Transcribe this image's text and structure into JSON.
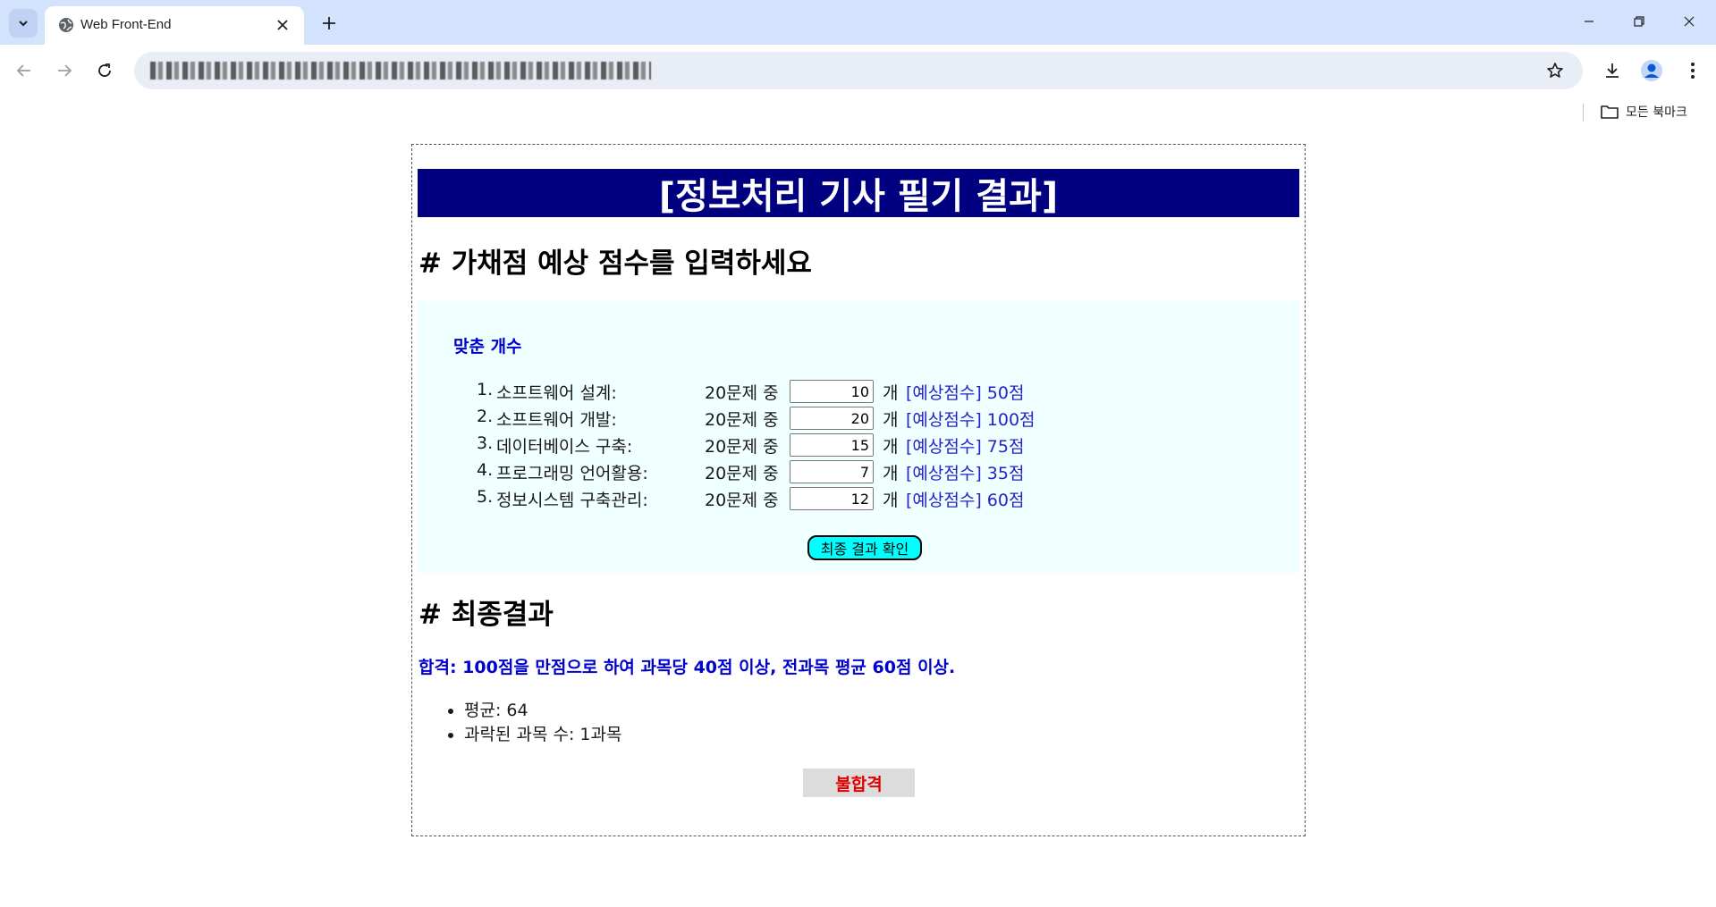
{
  "browser": {
    "tab_title": "Web Front-End",
    "bookmarks_label": "모든 북마크",
    "icons": {
      "tab_dropdown": "chevron-down-icon",
      "tab_favicon": "globe-icon",
      "tab_close": "close-icon",
      "new_tab": "plus-icon",
      "back": "arrow-left-icon",
      "forward": "arrow-right-icon",
      "reload": "reload-icon",
      "bookmark_star": "star-icon",
      "download": "download-icon",
      "profile": "profile-icon",
      "menu": "kebab-menu-icon",
      "bookmarks_folder": "folder-icon"
    }
  },
  "page": {
    "banner_title": "[정보처리 기사 필기 결과]",
    "input_heading": "# 가채점 예상 점수를 입력하세요",
    "panel_caption": "맞춘 개수",
    "question_prefix": "20문제 중",
    "count_unit": "개",
    "subjects": [
      {
        "num": "1.",
        "name": "소프트웨어 설계:",
        "correct": "10",
        "score_text": "[예상점수] 50점"
      },
      {
        "num": "2.",
        "name": "소프트웨어 개발:",
        "correct": "20",
        "score_text": "[예상점수] 100점"
      },
      {
        "num": "3.",
        "name": "데이터베이스 구축:",
        "correct": "15",
        "score_text": "[예상점수] 75점"
      },
      {
        "num": "4.",
        "name": "프로그래밍 언어활용:",
        "correct": "7",
        "score_text": "[예상점수] 35점"
      },
      {
        "num": "5.",
        "name": "정보시스템 구축관리:",
        "correct": "12",
        "score_text": "[예상점수] 60점"
      }
    ],
    "check_button": "최종 결과 확인",
    "result_heading": "# 최종결과",
    "criteria": "합격: 100점을 만점으로 하여 과목당 40점 이상, 전과목 평균 60점 이상.",
    "results": [
      "평균: 64",
      "과락된 과목 수: 1과목"
    ],
    "verdict": "불합격"
  },
  "colors": {
    "banner_bg": "#000080",
    "caption_blue": "#0000cd",
    "panel_bg": "#f0ffff",
    "button_bg": "#00ffff",
    "verdict_red": "#e00000",
    "tabbar_bg": "#d3e3fd"
  }
}
